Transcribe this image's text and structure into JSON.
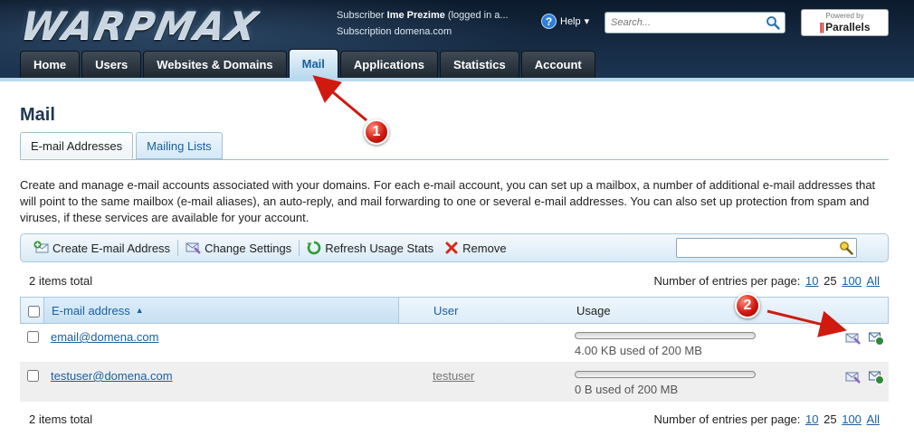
{
  "header": {
    "logo_text": "WARPMAX",
    "subscriber_prefix": "Subscriber ",
    "subscriber_name": "Ime Prezime",
    "subscriber_suffix": " (logged in a...",
    "subscription": "Subscription domena.com",
    "help_label": "Help",
    "help_arrow": "▾",
    "search_placeholder": "Search...",
    "powered_by": "Powered by",
    "parallels": "Parallels"
  },
  "nav": {
    "tabs": [
      "Home",
      "Users",
      "Websites & Domains",
      "Mail",
      "Applications",
      "Statistics",
      "Account"
    ],
    "active": "Mail"
  },
  "page": {
    "title": "Mail",
    "subtabs": [
      "E-mail Addresses",
      "Mailing Lists"
    ],
    "description": "Create and manage e-mail accounts associated with your domains. For each e-mail account, you can set up a mailbox, a number of additional e-mail addresses that will point to the same mailbox (e-mail aliases), an auto-reply, and mail forwarding to one or several e-mail addresses. You can also set up protection from spam and viruses, if these services are available for your account."
  },
  "toolbar": {
    "create": "Create E-mail Address",
    "change": "Change Settings",
    "refresh": "Refresh Usage Stats",
    "remove": "Remove"
  },
  "listing": {
    "total": "2 items total",
    "per_page_label": "Number of entries per page:",
    "per_page_options": [
      "10",
      "25",
      "100",
      "All"
    ],
    "per_page_current": "25",
    "columns": {
      "email": "E-mail address",
      "user": "User",
      "usage": "Usage"
    },
    "rows": [
      {
        "email": "email@domena.com",
        "user": "",
        "usage_text": "4.00 KB used of 200 MB",
        "usage_fraction": 2e-05
      },
      {
        "email": "testuser@domena.com",
        "user": "testuser",
        "usage_text": "0 B used of 200 MB",
        "usage_fraction": 0
      }
    ]
  },
  "annotations": {
    "step1": "1",
    "step2": "2"
  },
  "colors": {
    "accent": "#1a5fa0",
    "annotation": "#d01a10",
    "header_bg": "#14283f"
  }
}
